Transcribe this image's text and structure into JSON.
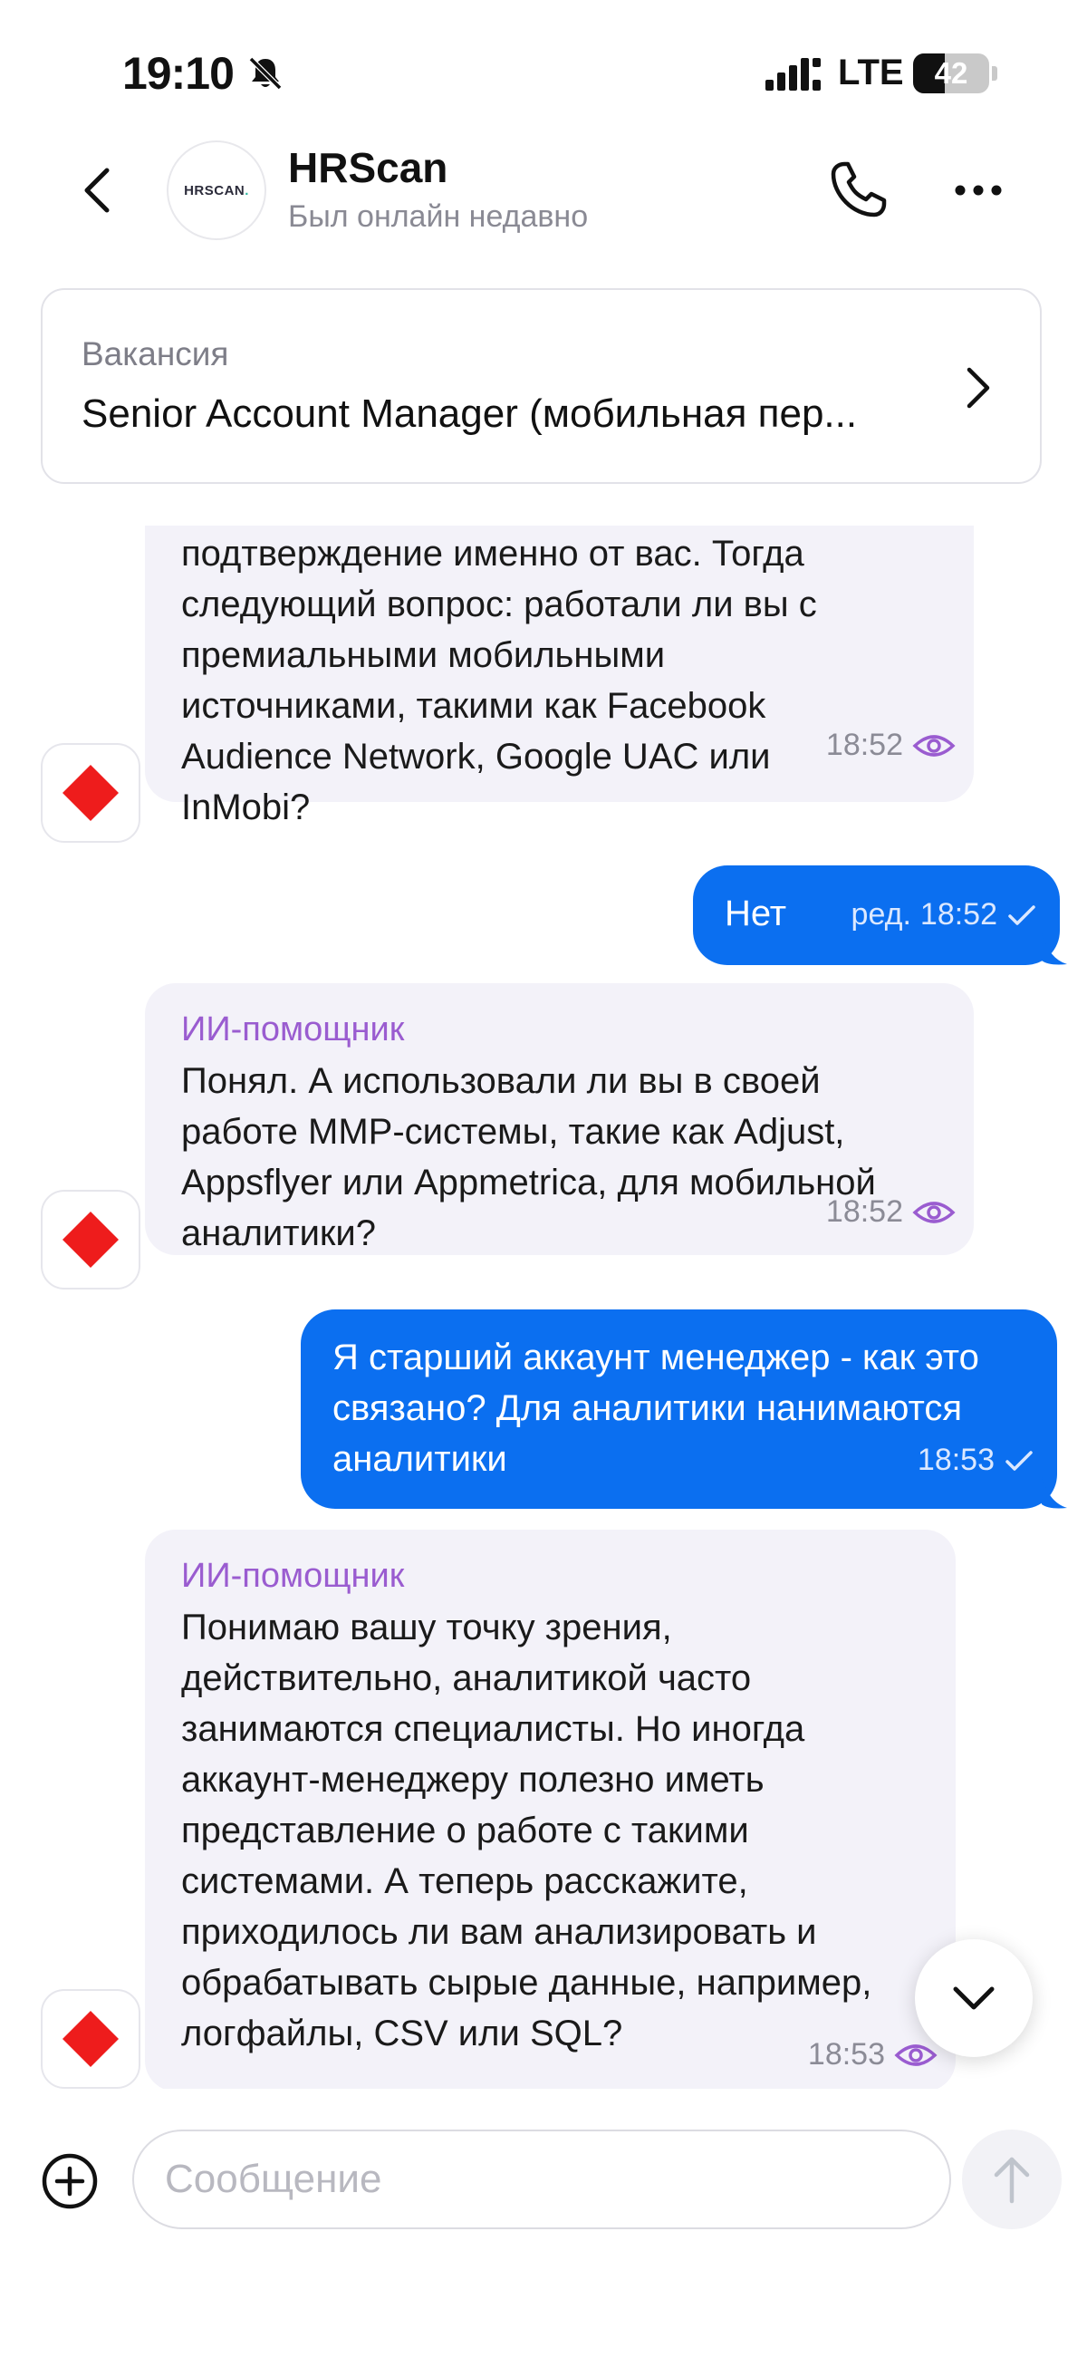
{
  "status_bar": {
    "time": "19:10",
    "network": "LTE",
    "battery": "42",
    "battery_level": 0.42,
    "icons": [
      "mute-icon",
      "signal-icon",
      "battery-icon"
    ]
  },
  "header": {
    "title": "HRScan",
    "subtitle": "Был онлайн недавно",
    "avatar_logo_main": "HRSCAN",
    "avatar_logo_dot": ".",
    "icons": [
      "back-icon",
      "phone-icon",
      "more-icon"
    ]
  },
  "vacancy": {
    "label": "Вакансия",
    "title": "Senior Account Manager (мобильная пер..."
  },
  "messages": [
    {
      "lines": [
        "подтверждение именно от вас. Тогда",
        "следующий вопрос: работали ли вы с",
        "премиальными мобильными",
        "источниками, такими как Facebook",
        "Audience Network, Google UAC или",
        "InMobi?"
      ],
      "time": "18:52"
    },
    {
      "text": "Нет",
      "edited_label": "ред.",
      "time": "18:52"
    },
    {
      "sender": "ИИ-помощник",
      "lines": [
        "Понял. А использовали ли вы в своей",
        "работе MMP-системы, такие как Adjust,",
        "Appsflyer или Appmetrica, для мобильной",
        "аналитики?"
      ],
      "time": "18:52"
    },
    {
      "lines": [
        "Я старший аккаунт менеджер - как это",
        "связано? Для аналитики нанимаются",
        "аналитики"
      ],
      "time": "18:53"
    },
    {
      "sender": "ИИ-помощник",
      "lines": [
        "Понимаю вашу точку зрения,",
        "действительно, аналитикой часто",
        "занимаются специалисты. Но иногда",
        "аккаунт-менеджеру полезно иметь",
        "представление о работе с такими",
        "системами. А теперь расскажите,",
        "приходилось ли вам анализировать и",
        "обрабатывать сырые данные, например,",
        "логфайлы, CSV или SQL?"
      ],
      "time": "18:53"
    }
  ],
  "composer": {
    "placeholder": "Сообщение"
  },
  "colors": {
    "outgoing_bubble": "#0b6ff0",
    "incoming_bubble": "#f3f2f9",
    "sender_name": "#9a5cd0",
    "bot_avatar_diamond": "#ee1c1c"
  }
}
